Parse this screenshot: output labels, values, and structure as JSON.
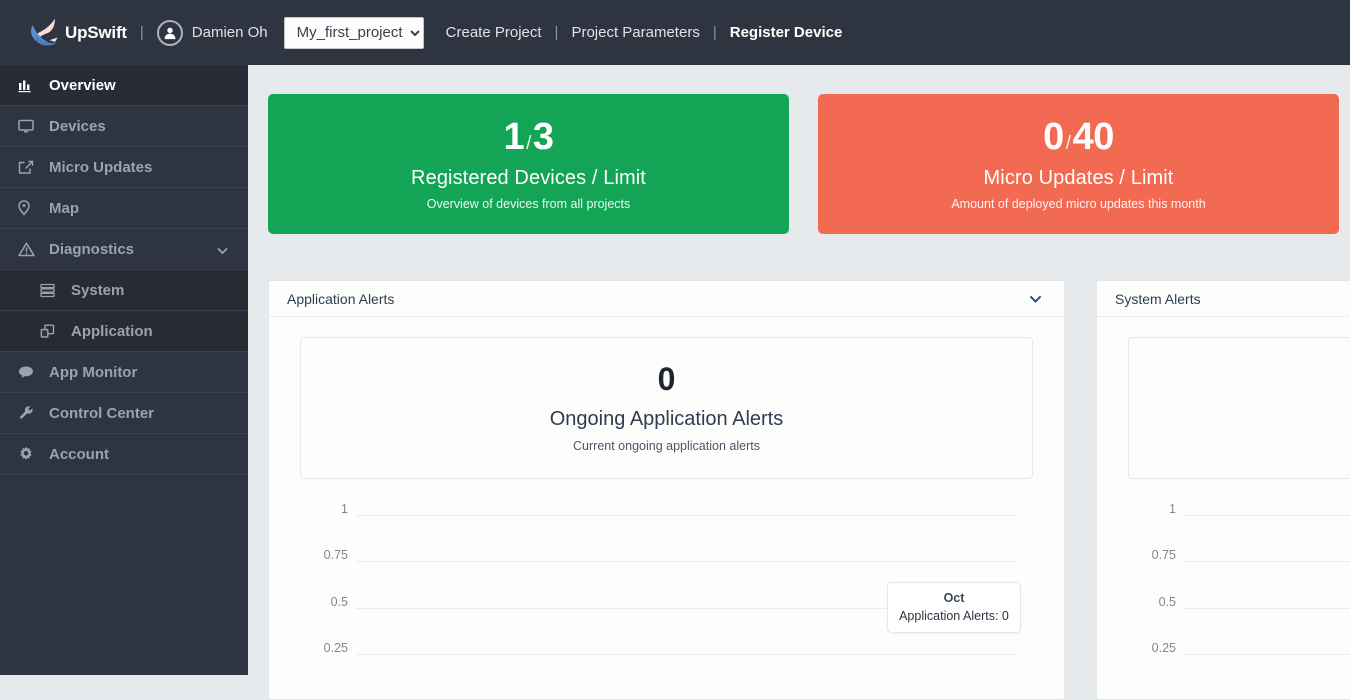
{
  "topnav": {
    "logo_text": "UpSwift",
    "logo_icon": "swift-bird-logo",
    "separator": "|",
    "avatar_icon": "user-avatar-icon",
    "user_name": "Damien Oh",
    "project_select": {
      "value": "My_first_project",
      "options": [
        "My_first_project"
      ]
    },
    "links": [
      {
        "label": "Create Project",
        "active": false,
        "name": "create-project"
      },
      {
        "label": "Project Parameters",
        "active": false,
        "name": "project-parameters"
      },
      {
        "label": "Register Device",
        "active": true,
        "name": "register-device"
      }
    ]
  },
  "sidebar": {
    "items": [
      {
        "label": "Overview",
        "icon": "bar-chart-icon",
        "active": true,
        "sub": false,
        "caret": false
      },
      {
        "label": "Devices",
        "icon": "monitor-icon",
        "active": false,
        "sub": false,
        "caret": false
      },
      {
        "label": "Micro Updates",
        "icon": "external-link-icon",
        "active": false,
        "sub": false,
        "caret": false
      },
      {
        "label": "Map",
        "icon": "map-pin-icon",
        "active": false,
        "sub": false,
        "caret": false
      },
      {
        "label": "Diagnostics",
        "icon": "warning-triangle-icon",
        "active": false,
        "sub": false,
        "caret": true
      },
      {
        "label": "System",
        "icon": "server-stack-icon",
        "active": false,
        "sub": true,
        "caret": false
      },
      {
        "label": "Application",
        "icon": "windows-app-icon",
        "active": false,
        "sub": true,
        "caret": false
      },
      {
        "label": "App Monitor",
        "icon": "chat-bubble-icon",
        "active": false,
        "sub": false,
        "caret": false
      },
      {
        "label": "Control Center",
        "icon": "wrench-icon",
        "active": false,
        "sub": false,
        "caret": false
      },
      {
        "label": "Account",
        "icon": "gear-icon",
        "active": false,
        "sub": false,
        "caret": false
      }
    ]
  },
  "stats": [
    {
      "value": "1",
      "separator": "/",
      "limit": "3",
      "title": "Registered Devices / Limit",
      "subtitle": "Overview of devices from all projects",
      "color": "#13a456",
      "name": "registered-devices-card"
    },
    {
      "value": "0",
      "separator": "/",
      "limit": "40",
      "title": "Micro Updates / Limit",
      "subtitle": "Amount of deployed micro updates this month",
      "color": "#f26a52",
      "name": "micro-updates-card"
    }
  ],
  "panels": [
    {
      "title": "Application Alerts",
      "has_caret": true,
      "kpi": {
        "number": "0",
        "title": "Ongoing Application Alerts",
        "subtitle": "Current ongoing application alerts"
      },
      "tooltip": {
        "header": "Oct",
        "body": "Application Alerts: 0"
      }
    },
    {
      "title": "System Alerts",
      "has_caret": false,
      "kpi": {
        "number": "",
        "title": "",
        "subtitle": ""
      },
      "tooltip": null
    }
  ],
  "chart_data": [
    {
      "type": "line",
      "title": "Application Alerts",
      "xlabel": "",
      "ylabel": "",
      "categories": [
        "Oct"
      ],
      "series": [
        {
          "name": "Application Alerts",
          "values": [
            0
          ]
        }
      ],
      "yticks": [
        "1",
        "0.75",
        "0.5",
        "0.25"
      ],
      "ylim": [
        0,
        1
      ],
      "grid": true,
      "legend": "none",
      "annotations": [
        {
          "label": "Oct",
          "text": "Application Alerts: 0"
        }
      ]
    },
    {
      "type": "line",
      "title": "System Alerts",
      "xlabel": "",
      "ylabel": "",
      "categories": [],
      "series": [
        {
          "name": "System Alerts",
          "values": []
        }
      ],
      "yticks": [
        "1",
        "0.75",
        "0.5",
        "0.25"
      ],
      "ylim": [
        0,
        1
      ],
      "grid": true,
      "legend": "none",
      "annotations": []
    }
  ]
}
